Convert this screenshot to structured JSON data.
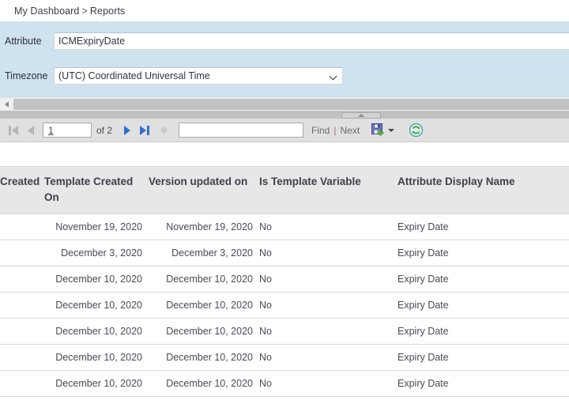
{
  "breadcrumb": {
    "items": [
      "My Dashboard",
      "Reports"
    ],
    "separator": ">"
  },
  "parameters": {
    "attribute": {
      "label": "Attribute",
      "value": "ICMExpiryDate",
      "placeholder": ""
    },
    "timezone": {
      "label": "Timezone",
      "value": "(UTC) Coordinated Universal Time",
      "caret_icon": "chevron-down-icon"
    }
  },
  "toolbar": {
    "first_page_icon": "first-page-icon",
    "prev_page_icon": "previous-page-icon",
    "page_number": "1",
    "page_total_label": "of 2",
    "next_page_icon": "next-page-icon",
    "last_page_icon": "last-page-icon",
    "stop_icon": "stop-refresh-icon",
    "find_value": "",
    "find_label": "Find",
    "separator": "|",
    "next_label": "Next",
    "export_icon": "export-save-icon",
    "export_caret_icon": "chevron-down-icon",
    "refresh_icon": "refresh-icon"
  },
  "scrollbar": {
    "left_arrow_icon": "scroll-left-icon",
    "splitter_icon": "collapse-up-icon"
  },
  "table": {
    "columns": [
      "Created",
      "Template Created On",
      "Version updated on",
      "Is Template Variable",
      "Attribute Display Name"
    ],
    "rows": [
      {
        "created": "",
        "template_created_on": "November 19, 2020",
        "version_updated_on": "November 19, 2020",
        "is_template_variable": "No",
        "attribute_display_name": "Expiry Date"
      },
      {
        "created": "",
        "template_created_on": "December 3, 2020",
        "version_updated_on": "December 3, 2020",
        "is_template_variable": "No",
        "attribute_display_name": "Expiry Date"
      },
      {
        "created": "",
        "template_created_on": "December 10, 2020",
        "version_updated_on": "December 10, 2020",
        "is_template_variable": "No",
        "attribute_display_name": "Expiry Date"
      },
      {
        "created": "",
        "template_created_on": "December 10, 2020",
        "version_updated_on": "December 10, 2020",
        "is_template_variable": "No",
        "attribute_display_name": "Expiry Date"
      },
      {
        "created": "",
        "template_created_on": "December 10, 2020",
        "version_updated_on": "December 10, 2020",
        "is_template_variable": "No",
        "attribute_display_name": "Expiry Date"
      },
      {
        "created": "",
        "template_created_on": "December 10, 2020",
        "version_updated_on": "December 10, 2020",
        "is_template_variable": "No",
        "attribute_display_name": "Expiry Date"
      },
      {
        "created": "",
        "template_created_on": "December 10, 2020",
        "version_updated_on": "December 10, 2020",
        "is_template_variable": "No",
        "attribute_display_name": "Expiry Date"
      }
    ]
  },
  "colors": {
    "param_panel_bg": "#cfe2ef",
    "toolbar_bg": "#e0e0e0",
    "table_header_bg": "#e7e7e7",
    "nav_enabled": "#2f6fd0",
    "nav_disabled": "#b6b6b6"
  }
}
